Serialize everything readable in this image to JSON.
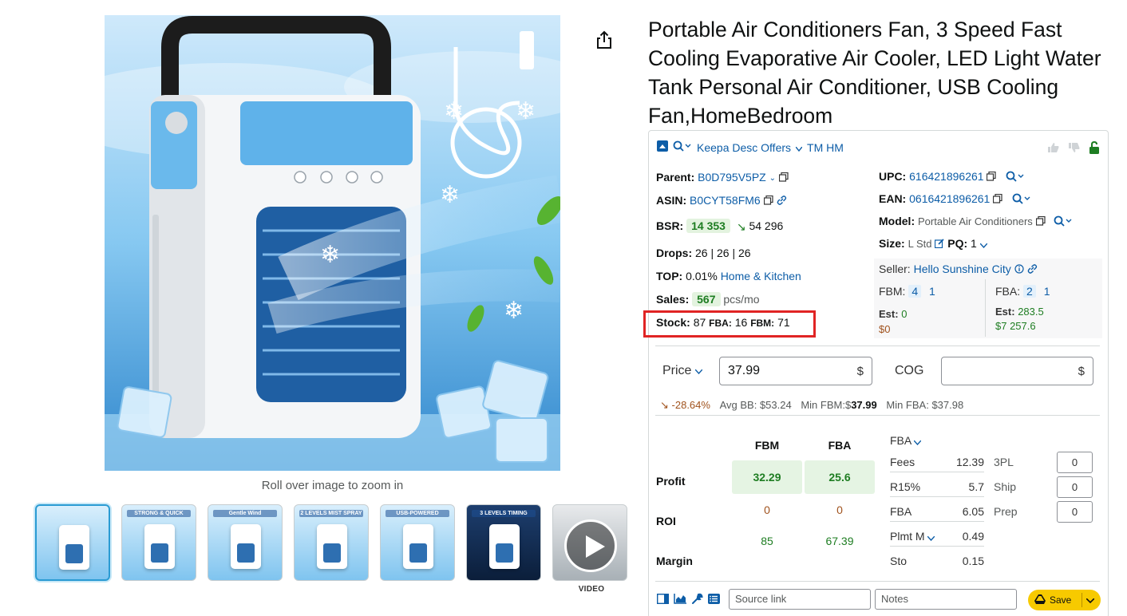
{
  "gallery": {
    "zoom_hint": "Roll over image to zoom in",
    "video_label": "VIDEO",
    "thumbnails": [
      {
        "caption": ""
      },
      {
        "caption": "STRONG & QUICK"
      },
      {
        "caption": "Gentle Wind"
      },
      {
        "caption": "2 LEVELS MIST SPRAY"
      },
      {
        "caption": "USB-POWERED"
      },
      {
        "caption": "3 LEVELS TIMING"
      },
      {
        "caption": ""
      }
    ]
  },
  "product": {
    "title": "Portable Air Conditioners Fan, 3 Speed Fast Cooling Evaporative Air Cooler, LED Light Water Tank Personal Air Conditioner, USB Cooling Fan,HomeBedroom"
  },
  "keepa": {
    "header": {
      "menu": "Keepa Desc Offers",
      "tm": "TM HM"
    },
    "parent_label": "Parent:",
    "parent_value": "B0D795V5PZ",
    "asin_label": "ASIN:",
    "asin_value": "B0CYT58FM6",
    "bsr_label": "BSR:",
    "bsr_value": "14 353",
    "bsr_prev": "54 296",
    "drops_label": "Drops:",
    "drops_value": "26 | 26 | 26",
    "top_label": "TOP:",
    "top_value": "0.01%",
    "top_category": "Home & Kitchen",
    "sales_label": "Sales:",
    "sales_value": "567",
    "sales_unit": "pcs/mo",
    "stock_label": "Stock:",
    "stock_value": "87",
    "stock_fba_label": "FBA:",
    "stock_fba": "16",
    "stock_fbm_label": "FBM:",
    "stock_fbm": "71",
    "upc_label": "UPC:",
    "upc_value": "616421896261",
    "ean_label": "EAN:",
    "ean_value": "0616421896261",
    "model_label": "Model:",
    "model_value": "Portable Air Conditioners",
    "size_label": "Size:",
    "size_value": "L Std",
    "pq_label": "PQ:",
    "pq_value": "1",
    "seller_label": "Seller:",
    "seller_value": "Hello Sunshine City",
    "fbm_label": "FBM:",
    "fbm_count": "4",
    "fbm_count2": "1",
    "fba_label": "FBA:",
    "fba_count": "2",
    "fba_count2": "1",
    "est_fbm_label": "Est:",
    "est_fbm_value": "0",
    "est_fbm_money": "$0",
    "est_fba_label": "Est:",
    "est_fba_value": "283.5",
    "est_fba_money": "$7 257.6",
    "price_label": "Price",
    "price_value": "37.99",
    "currency": "$",
    "cog_label": "COG",
    "cog_value": "",
    "change_pct": "-28.64%",
    "avg_bb_label": "Avg BB:",
    "avg_bb": "$53.24",
    "min_fbm_label": "Min FBM:",
    "min_fbm_cur": "$",
    "min_fbm": "37.99",
    "min_fba_label": "Min FBA:",
    "min_fba": "$37.98",
    "col_fbm": "FBM",
    "col_fba": "FBA",
    "profit_label": "Profit",
    "profit_fbm": "32.29",
    "profit_fba": "25.6",
    "roi_label": "ROI",
    "roi_fbm": "0",
    "roi_fba": "0",
    "margin_label": "Margin",
    "margin_fbm": "85",
    "margin_fba": "67.39",
    "fees_mode": "FBA",
    "fees": [
      {
        "label": "Fees",
        "value": "12.39"
      },
      {
        "label": "R15%",
        "value": "5.7"
      },
      {
        "label": "FBA",
        "value": "6.05"
      },
      {
        "label": "Plmt M",
        "value": "0.49"
      },
      {
        "label": "Sto",
        "value": "0.15"
      }
    ],
    "extras": [
      {
        "label": "3PL",
        "value": "0"
      },
      {
        "label": "Ship",
        "value": "0"
      },
      {
        "label": "Prep",
        "value": "0"
      }
    ],
    "source_placeholder": "Source link",
    "notes_placeholder": "Notes",
    "save_label": "Save"
  },
  "colors": {
    "accent": "#0d5da7",
    "positive": "#1e7d22",
    "negative": "#a0521d",
    "highlight": "#e02424",
    "save": "#f7ca00"
  }
}
